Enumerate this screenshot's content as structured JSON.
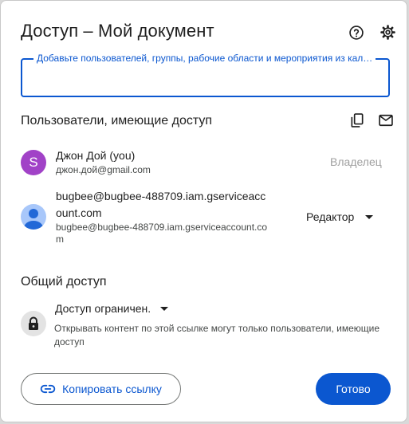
{
  "dialog": {
    "title": "Доступ – Мой документ",
    "help_icon": "help-circle-icon",
    "settings_icon": "gear-icon"
  },
  "add_people": {
    "placeholder": "Добавьте пользователей, группы, рабочие области и мероприятия из кал…",
    "value": ""
  },
  "people_section": {
    "title": "Пользователи, имеющие доступ",
    "copy_emails_icon": "copy-icon",
    "email_icon": "mail-icon",
    "people": [
      {
        "avatar_letter": "S",
        "avatar_color": "#a142c7",
        "name": "Джон Дой (you)",
        "email": "джон.дой@gmail.com",
        "role": "Владелец"
      },
      {
        "avatar_icon": "generic-user-icon",
        "name_line1": "bugbee@bugbee-488709.iam.gserviceacc",
        "name_line2": "ount.com",
        "email_line1": "bugbee@bugbee-488709.iam.gserviceaccount.co",
        "email_line2": "m",
        "role": "Редактор"
      }
    ]
  },
  "general_access": {
    "title": "Общий доступ",
    "lock_icon": "lock-icon",
    "selected": "Доступ ограничен.",
    "description": "Открывать контент по этой ссылке могут только пользователи, имеющие доступ"
  },
  "footer": {
    "copy_link_label": "Копировать ссылку",
    "link_icon": "link-icon",
    "done_label": "Готово"
  },
  "colors": {
    "accent": "#0b57d0",
    "owner_avatar": "#a142c7"
  }
}
